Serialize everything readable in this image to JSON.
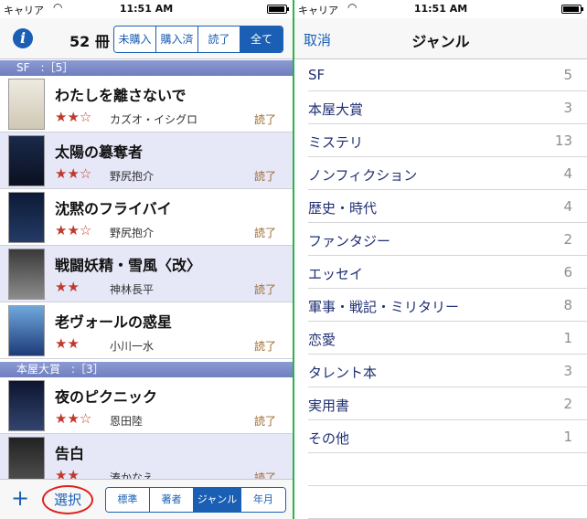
{
  "status": {
    "carrier": "キャリア",
    "time": "11:51 AM"
  },
  "left": {
    "count": "52 冊",
    "filters": [
      "未購入",
      "購入済",
      "読了",
      "全て"
    ],
    "sections": [
      {
        "header": "SF　:［5］"
      },
      {
        "header": "本屋大賞　:［3］"
      }
    ],
    "books": [
      {
        "title": "わたしを離さないで",
        "stars": "★★☆",
        "author": "カズオ・イシグロ",
        "state": "読了"
      },
      {
        "title": "太陽の簒奪者",
        "stars": "★★☆",
        "author": "野尻抱介",
        "state": "読了"
      },
      {
        "title": "沈黙のフライバイ",
        "stars": "★★☆",
        "author": "野尻抱介",
        "state": "読了"
      },
      {
        "title": "戦闘妖精・雪風〈改〉",
        "stars": "★★",
        "author": "神林長平",
        "state": "読了"
      },
      {
        "title": "老ヴォールの惑星",
        "stars": "★★",
        "author": "小川一水",
        "state": "読了"
      },
      {
        "title": "夜のピクニック",
        "stars": "★★☆",
        "author": "恩田陸",
        "state": "読了"
      },
      {
        "title": "告白",
        "stars": "★★",
        "author": "湊かなえ",
        "state": "読了"
      }
    ],
    "footer": {
      "plus": "+",
      "select": "選択",
      "sort": [
        "標準",
        "著者",
        "ジャンル",
        "年月"
      ]
    }
  },
  "right": {
    "cancel": "取消",
    "title": "ジャンル",
    "genres": [
      {
        "name": "SF",
        "count": "5"
      },
      {
        "name": "本屋大賞",
        "count": "3"
      },
      {
        "name": "ミステリ",
        "count": "13"
      },
      {
        "name": "ノンフィクション",
        "count": "4"
      },
      {
        "name": "歴史・時代",
        "count": "4"
      },
      {
        "name": "ファンタジー",
        "count": "2"
      },
      {
        "name": "エッセイ",
        "count": "6"
      },
      {
        "name": "軍事・戦記・ミリタリー",
        "count": "8"
      },
      {
        "name": "恋愛",
        "count": "1"
      },
      {
        "name": "タレント本",
        "count": "3"
      },
      {
        "name": "実用書",
        "count": "2"
      },
      {
        "name": "その他",
        "count": "1"
      }
    ]
  },
  "icons": {
    "info": "info-icon",
    "wifi": "wifi-icon",
    "battery": "battery-icon",
    "plus": "plus-icon"
  },
  "colors": {
    "accent": "#1a5fb4",
    "divider": "#2db24a",
    "star": "#c0392b",
    "highlight": "#e02020"
  }
}
